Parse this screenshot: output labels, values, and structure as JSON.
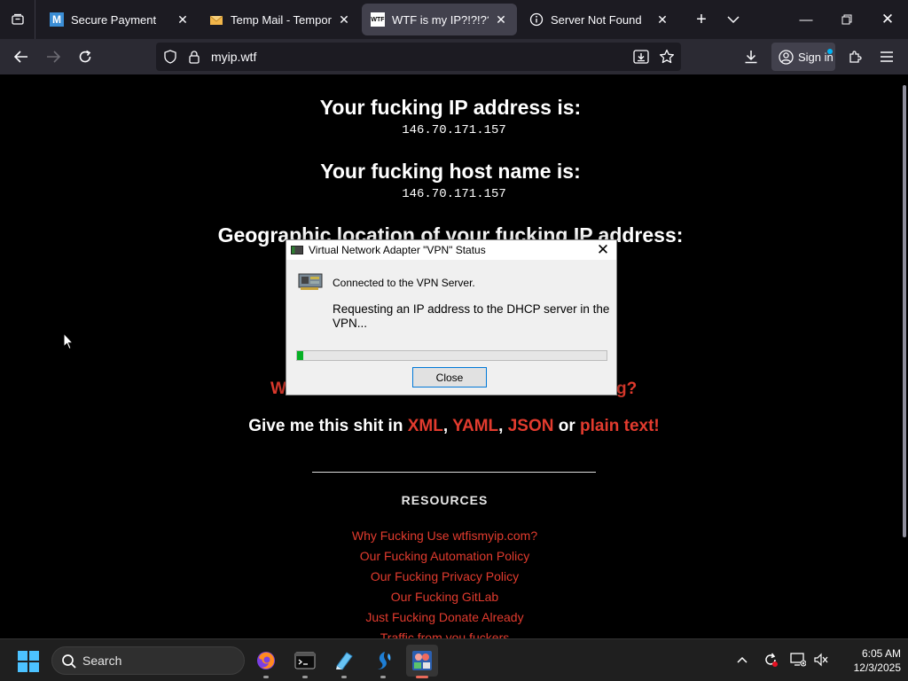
{
  "browser": {
    "tabs": [
      {
        "title": "Secure Payment",
        "icon": "m-logo-icon"
      },
      {
        "title": "Temp Mail - Temporary",
        "icon": "envelope-icon"
      },
      {
        "title": "WTF is my IP?!?!??",
        "icon": "wtf-favicon",
        "favicon_text": "WTF",
        "active": true
      },
      {
        "title": "Server Not Found",
        "icon": "info-circle-icon"
      }
    ],
    "url": "myip.wtf",
    "sign_in_label": "Sign in"
  },
  "page": {
    "ip_heading": "Your fucking IP address is:",
    "ip_value": "146.70.171.157",
    "host_heading": "Your fucking host name is:",
    "host_value": "146.70.171.157",
    "geo_heading": "Geographic location of your fucking IP address:",
    "partial_red_left": "W",
    "partial_red_right": "g?",
    "give_prefix": "Give me this shit in",
    "formats": [
      "XML",
      "YAML",
      "JSON",
      "plain text!"
    ],
    "format_separators": [
      ", ",
      ", ",
      " or "
    ],
    "resources_heading": "RESOURCES",
    "resource_links": [
      "Why Fucking Use wtfismyip.com?",
      "Our Fucking Automation Policy",
      "Our Fucking Privacy Policy",
      "Our Fucking GitLab",
      "Just Fucking Donate Already",
      "Traffic from you fuckers"
    ],
    "accent_color": "#e23b2e"
  },
  "dialog": {
    "title": "Virtual Network Adapter \"VPN\" Status",
    "status_line": "Connected to the VPN Server.",
    "message": "Requesting an IP address to the DHCP server in the VPN...",
    "progress_fraction": 0.02,
    "close_label": "Close"
  },
  "taskbar": {
    "search_placeholder": "Search",
    "apps": [
      "firefox-icon",
      "terminal-icon",
      "notepad-icon",
      "softether-icon",
      "vpn-manager-icon"
    ],
    "time": "6:05 AM",
    "date": "12/3/2025"
  }
}
